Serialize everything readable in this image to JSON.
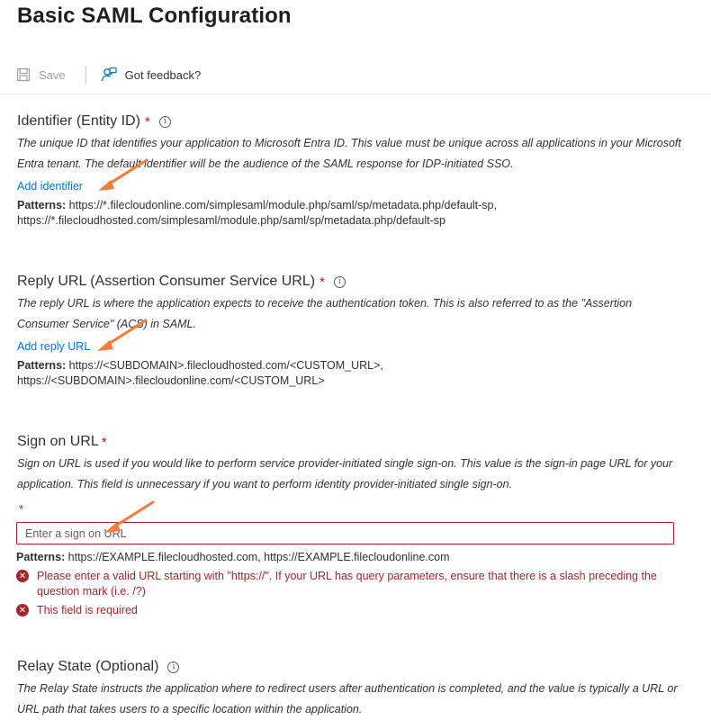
{
  "page": {
    "title": "Basic SAML Configuration"
  },
  "toolbar": {
    "save_label": "Save",
    "feedback_label": "Got feedback?"
  },
  "identifier": {
    "title": "Identifier (Entity ID)",
    "required_mark": "*",
    "info_glyph": "i",
    "description": "The unique ID that identifies your application to Microsoft Entra ID. This value must be unique across all applications in your Microsoft Entra tenant. The default identifier will be the audience of the SAML response for IDP-initiated SSO.",
    "link_label": "Add identifier",
    "patterns_label": "Patterns:",
    "patterns_line1": " https://*.filecloudonline.com/simplesaml/module.php/saml/sp/metadata.php/default-sp,",
    "patterns_line2": "https://*.filecloudhosted.com/simplesaml/module.php/saml/sp/metadata.php/default-sp"
  },
  "reply_url": {
    "title": "Reply URL (Assertion Consumer Service URL)",
    "required_mark": "*",
    "info_glyph": "i",
    "description": "The reply URL is where the application expects to receive the authentication token. This is also referred to as the \"Assertion Consumer Service\" (ACS) in SAML.",
    "link_label": "Add reply URL",
    "patterns_label": "Patterns:",
    "patterns_line1": " https://<SUBDOMAIN>.filecloudhosted.com/<CUSTOM_URL>,",
    "patterns_line2": "https://<SUBDOMAIN>.filecloudonline.com/<CUSTOM_URL>"
  },
  "sign_on": {
    "title": "Sign on URL",
    "required_mark": "*",
    "description": "Sign on URL is used if you would like to perform service provider-initiated single sign-on. This value is the sign-in page URL for your application. This field is unnecessary if you want to perform identity provider-initiated single sign-on.",
    "field_required_mark": "*",
    "input_placeholder": "Enter a sign on URL",
    "input_value": "",
    "patterns_label": "Patterns:",
    "patterns_text": " https://EXAMPLE.filecloudhosted.com, https://EXAMPLE.filecloudonline.com",
    "error1": "Please enter a valid URL starting with \"https://\". If your URL has query parameters, ensure that there is a slash preceding the question mark (i.e. /?)",
    "error2": "This field is required",
    "error_glyph": "✕"
  },
  "relay_state": {
    "title": "Relay State (Optional)",
    "info_glyph": "i",
    "description": "The Relay State instructs the application where to redirect users after authentication is completed, and the value is typically a URL or URL path that takes users to a specific location within the application."
  },
  "colors": {
    "link": "#0078d4",
    "error": "#a4262c",
    "annotation_arrow": "#f47c3c"
  },
  "icons": [
    "save-icon",
    "feedback-icon",
    "info-icon",
    "error-icon",
    "annotation-arrow"
  ]
}
